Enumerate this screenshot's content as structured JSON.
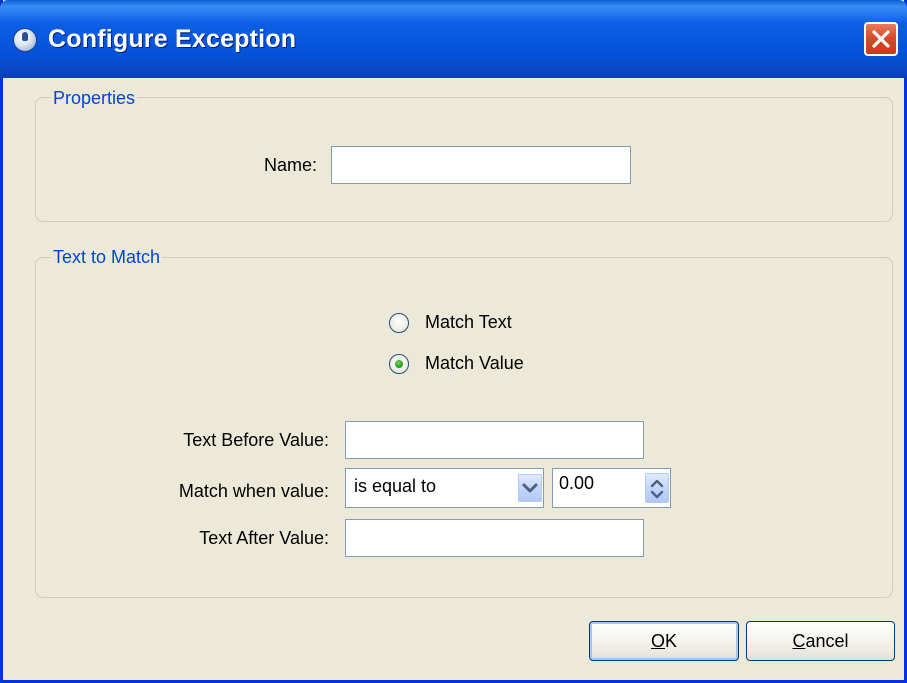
{
  "window": {
    "title": "Configure Exception"
  },
  "properties": {
    "group_label": "Properties",
    "name_label": "Name:",
    "name_value": ""
  },
  "text_to_match": {
    "group_label": "Text to Match",
    "radio_options": [
      {
        "label": "Match Text",
        "selected": false
      },
      {
        "label": "Match Value",
        "selected": true
      }
    ],
    "text_before_label": "Text Before Value:",
    "text_before_value": "",
    "match_when_label": "Match when value:",
    "match_when_selected": "is equal to",
    "match_value": "0.00",
    "text_after_label": "Text After Value:",
    "text_after_value": ""
  },
  "buttons": {
    "ok_accel": "O",
    "ok_rest": "K",
    "cancel_accel": "C",
    "cancel_rest": "ancel"
  },
  "colors": {
    "titlebar": "#0551d8",
    "group_label": "#0046d5",
    "dialog_bg": "#ece9d8",
    "close_button": "#d94b2a",
    "radio_dot": "#21a121"
  },
  "icons": [
    "app-icon",
    "close-icon",
    "chevron-down-icon",
    "spin-up-icon",
    "spin-down-icon"
  ]
}
